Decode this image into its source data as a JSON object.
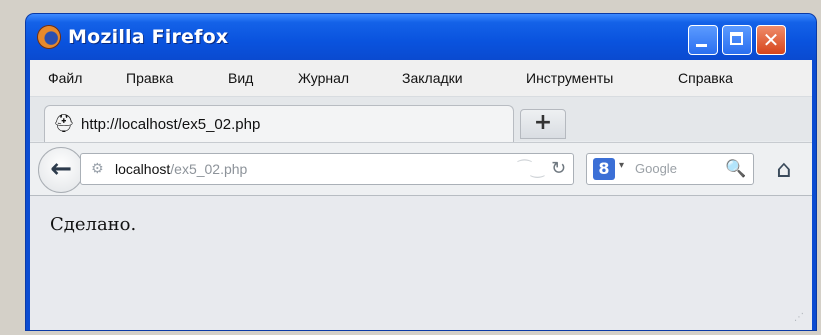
{
  "window": {
    "title": "Mozilla Firefox",
    "controls": {
      "minimize_icon": "minimize-icon",
      "maximize_icon": "maximize-icon",
      "close_glyph": "✕"
    }
  },
  "menu": {
    "items": [
      {
        "label": "Файл"
      },
      {
        "label": "Правка"
      },
      {
        "label": "Вид"
      },
      {
        "label": "Журнал"
      },
      {
        "label": "Закладки"
      },
      {
        "label": "Инструменты"
      },
      {
        "label": "Справка"
      }
    ]
  },
  "tabs": {
    "active": {
      "title": "http://localhost/ex5_02.php",
      "icon": "spy-icon"
    },
    "new_tab_label": "+"
  },
  "navbar": {
    "url_host": "localhost",
    "url_path": "/ex5_02.php",
    "search_engine_badge": "8",
    "search_placeholder": "Google"
  },
  "page": {
    "text": "Сделано."
  }
}
